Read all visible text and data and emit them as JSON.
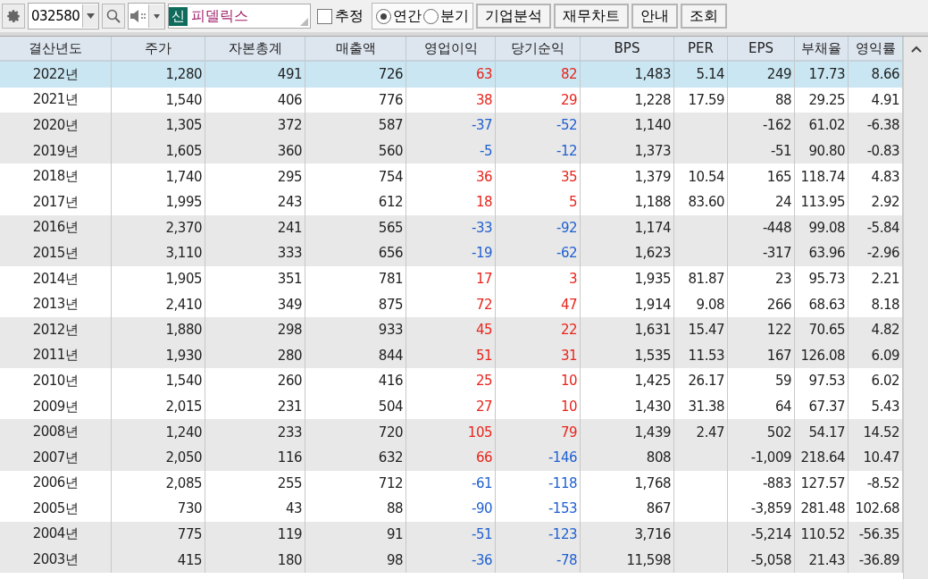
{
  "toolbar": {
    "code": "032580",
    "badge": "신",
    "name": "피델릭스",
    "checkbox": {
      "label": "추정",
      "checked": false
    },
    "radios": [
      {
        "label": "연간",
        "selected": true
      },
      {
        "label": "분기",
        "selected": false
      }
    ],
    "buttons": [
      "기업분석",
      "재무차트",
      "안내",
      "조회"
    ]
  },
  "table": {
    "columns": [
      "결산년도",
      "주가",
      "자본총계",
      "매출액",
      "영업이익",
      "당기순익",
      "BPS",
      "PER",
      "EPS",
      "부채율",
      "영익률"
    ],
    "rows": [
      {
        "selected": true,
        "cells": [
          "2022년",
          "1,280",
          "491",
          "726",
          {
            "text": "63",
            "color": "#e8251c"
          },
          {
            "text": "82",
            "color": "#e8251c"
          },
          "1,483",
          "5.14",
          "249",
          "17.73",
          "8.66"
        ]
      },
      {
        "selected": false,
        "cells": [
          "2021년",
          "1,540",
          "406",
          "776",
          {
            "text": "38",
            "color": "#e8251c"
          },
          {
            "text": "29",
            "color": "#e8251c"
          },
          "1,228",
          "17.59",
          "88",
          "29.25",
          "4.91"
        ]
      },
      {
        "selected": false,
        "cells": [
          "2020년",
          "1,305",
          "372",
          "587",
          {
            "text": "-37",
            "color": "#1f5fd0"
          },
          {
            "text": "-52",
            "color": "#1f5fd0"
          },
          "1,140",
          "",
          "-162",
          "61.02",
          "-6.38"
        ]
      },
      {
        "selected": false,
        "cells": [
          "2019년",
          "1,605",
          "360",
          "560",
          {
            "text": "-5",
            "color": "#1f5fd0"
          },
          {
            "text": "-12",
            "color": "#1f5fd0"
          },
          "1,373",
          "",
          "-51",
          "90.80",
          "-0.83"
        ]
      },
      {
        "selected": false,
        "cells": [
          "2018년",
          "1,740",
          "295",
          "754",
          {
            "text": "36",
            "color": "#e8251c"
          },
          {
            "text": "35",
            "color": "#e8251c"
          },
          "1,379",
          "10.54",
          "165",
          "118.74",
          "4.83"
        ]
      },
      {
        "selected": false,
        "cells": [
          "2017년",
          "1,995",
          "243",
          "612",
          {
            "text": "18",
            "color": "#e8251c"
          },
          {
            "text": "5",
            "color": "#e8251c"
          },
          "1,188",
          "83.60",
          "24",
          "113.95",
          "2.92"
        ]
      },
      {
        "selected": false,
        "cells": [
          "2016년",
          "2,370",
          "241",
          "565",
          {
            "text": "-33",
            "color": "#1f5fd0"
          },
          {
            "text": "-92",
            "color": "#1f5fd0"
          },
          "1,174",
          "",
          "-448",
          "99.08",
          "-5.84"
        ]
      },
      {
        "selected": false,
        "cells": [
          "2015년",
          "3,110",
          "333",
          "656",
          {
            "text": "-19",
            "color": "#1f5fd0"
          },
          {
            "text": "-62",
            "color": "#1f5fd0"
          },
          "1,623",
          "",
          "-317",
          "63.96",
          "-2.96"
        ]
      },
      {
        "selected": false,
        "cells": [
          "2014년",
          "1,905",
          "351",
          "781",
          {
            "text": "17",
            "color": "#e8251c"
          },
          {
            "text": "3",
            "color": "#e8251c"
          },
          "1,935",
          "81.87",
          "23",
          "95.73",
          "2.21"
        ]
      },
      {
        "selected": false,
        "cells": [
          "2013년",
          "2,410",
          "349",
          "875",
          {
            "text": "72",
            "color": "#e8251c"
          },
          {
            "text": "47",
            "color": "#e8251c"
          },
          "1,914",
          "9.08",
          "266",
          "68.63",
          "8.18"
        ]
      },
      {
        "selected": false,
        "cells": [
          "2012년",
          "1,880",
          "298",
          "933",
          {
            "text": "45",
            "color": "#e8251c"
          },
          {
            "text": "22",
            "color": "#e8251c"
          },
          "1,631",
          "15.47",
          "122",
          "70.65",
          "4.82"
        ]
      },
      {
        "selected": false,
        "cells": [
          "2011년",
          "1,930",
          "280",
          "844",
          {
            "text": "51",
            "color": "#e8251c"
          },
          {
            "text": "31",
            "color": "#e8251c"
          },
          "1,535",
          "11.53",
          "167",
          "126.08",
          "6.09"
        ]
      },
      {
        "selected": false,
        "cells": [
          "2010년",
          "1,540",
          "260",
          "416",
          {
            "text": "25",
            "color": "#e8251c"
          },
          {
            "text": "10",
            "color": "#e8251c"
          },
          "1,425",
          "26.17",
          "59",
          "97.53",
          "6.02"
        ]
      },
      {
        "selected": false,
        "cells": [
          "2009년",
          "2,015",
          "231",
          "504",
          {
            "text": "27",
            "color": "#e8251c"
          },
          {
            "text": "10",
            "color": "#e8251c"
          },
          "1,430",
          "31.38",
          "64",
          "67.37",
          "5.43"
        ]
      },
      {
        "selected": false,
        "cells": [
          "2008년",
          "1,240",
          "233",
          "720",
          {
            "text": "105",
            "color": "#e8251c"
          },
          {
            "text": "79",
            "color": "#e8251c"
          },
          "1,439",
          "2.47",
          "502",
          "54.17",
          "14.52"
        ]
      },
      {
        "selected": false,
        "cells": [
          "2007년",
          "2,050",
          "116",
          "632",
          {
            "text": "66",
            "color": "#e8251c"
          },
          {
            "text": "-146",
            "color": "#1f5fd0"
          },
          "808",
          "",
          "-1,009",
          "218.64",
          "10.47"
        ]
      },
      {
        "selected": false,
        "cells": [
          "2006년",
          "2,085",
          "255",
          "712",
          {
            "text": "-61",
            "color": "#1f5fd0"
          },
          {
            "text": "-118",
            "color": "#1f5fd0"
          },
          "1,768",
          "",
          "-883",
          "127.57",
          "-8.52"
        ]
      },
      {
        "selected": false,
        "cells": [
          "2005년",
          "730",
          "43",
          "88",
          {
            "text": "-90",
            "color": "#1f5fd0"
          },
          {
            "text": "-153",
            "color": "#1f5fd0"
          },
          "867",
          "",
          "-3,859",
          "281.48",
          "102.68"
        ]
      },
      {
        "selected": false,
        "cells": [
          "2004년",
          "775",
          "119",
          "91",
          {
            "text": "-51",
            "color": "#1f5fd0"
          },
          {
            "text": "-123",
            "color": "#1f5fd0"
          },
          "3,716",
          "",
          "-5,214",
          "110.52",
          "-56.35"
        ]
      },
      {
        "selected": false,
        "cells": [
          "2003년",
          "415",
          "180",
          "98",
          {
            "text": "-36",
            "color": "#1f5fd0"
          },
          {
            "text": "-78",
            "color": "#1f5fd0"
          },
          "11,598",
          "",
          "-5,058",
          "21.43",
          "-36.89"
        ]
      }
    ]
  }
}
